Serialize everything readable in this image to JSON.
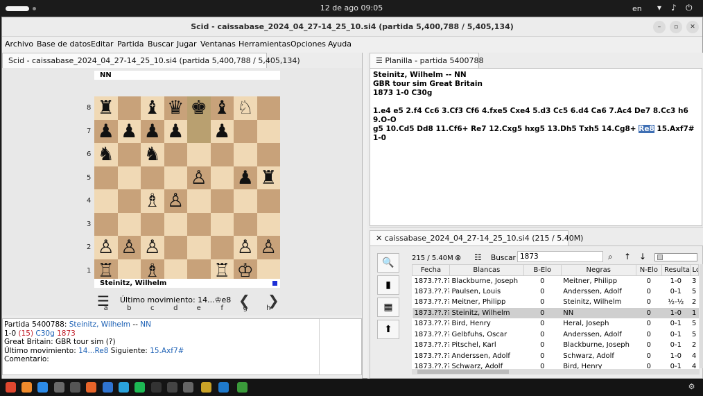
{
  "topbar": {
    "clock": "12 de ago  09:05",
    "lang": "en",
    "wifi_icon": "wifi-icon",
    "volume_icon": "volume-icon",
    "power_icon": "power-icon"
  },
  "window": {
    "title": "Scid - caissabase_2024_04_27-14_25_10.si4 (partida 5,400,788 / 5,405,134)",
    "minimize": "–",
    "restore": "▫",
    "close": "✕"
  },
  "menu": [
    "Archivo",
    "Base de datos",
    "Editar",
    "Partida",
    "Buscar",
    "Jugar",
    "Ventanas",
    "Herramientas",
    "Opciones",
    "Ayuda"
  ],
  "left": {
    "tab": "Scid - caissabase_2024_04_27-14_25_10.si4 (partida 5,400,788 / 5,405,134)",
    "black_player": "NN",
    "white_player": "Steinitz, Wilhelm",
    "ranks": [
      "8",
      "7",
      "6",
      "5",
      "4",
      "3",
      "2",
      "1"
    ],
    "files": [
      "a",
      "b",
      "c",
      "d",
      "e",
      "f",
      "g",
      "h"
    ],
    "board": [
      [
        "♜",
        "",
        "♝",
        "♛",
        "♚",
        "♝",
        "♘",
        ""
      ],
      [
        "♟",
        "♟",
        "♟",
        "♟",
        "",
        "♟",
        "",
        ""
      ],
      [
        "♞",
        "",
        "♞",
        "",
        "",
        "",
        "",
        ""
      ],
      [
        "",
        "",
        "",
        "",
        "♙",
        "",
        "♟",
        "♜"
      ],
      [
        "",
        "",
        "♗",
        "♙",
        "",
        "",
        "",
        ""
      ],
      [
        "",
        "",
        "",
        "",
        "",
        "",
        "",
        ""
      ],
      [
        "♙",
        "♙",
        "♙",
        "",
        "",
        "",
        "♙",
        "♙"
      ],
      [
        "♖",
        "",
        "♗",
        "",
        "",
        "♖",
        "♔",
        ""
      ]
    ],
    "last_move_label": "Último movimiento: 14...♔e8",
    "prev": "❮",
    "next": "❯",
    "info": {
      "line1_prefix": "Partida 5400788:",
      "white": "Steinitz, Wilhelm",
      "sep": "--",
      "black": "NN",
      "result": "1-0",
      "moves": "(15)",
      "eco": "C30g",
      "year": "1873",
      "event_prefix": "Great Britain:",
      "event": "GBR tour sim (?)",
      "last_label": "Último movimiento:",
      "last_move": "14...Re8",
      "next_label": "Siguiente:",
      "next_move": "15.Axf7#",
      "comment_label": "Comentario:"
    }
  },
  "right": {
    "notation_tab": "Planilla - partida 5400788",
    "header1": "Steinitz, Wilhelm   --   NN",
    "header2": "GBR tour sim  Great Britain",
    "header3": "1873  1-0  C30g",
    "moves_a": "1.e4 e5 2.f4 Cc6 3.Cf3 Cf6 4.fxe5 Cxe4 5.d3 Cc5 6.d4 Ca6 7.Ac4 De7 8.Cc3 h6 9.O-O",
    "moves_b": "g5 10.Cd5 Dd8 11.Cf6+ Re7 12.Cxg5 hxg5 13.Dh5 Txh5 14.Cg8+",
    "moves_hl": "Re8",
    "moves_c": "15.Axf7# 1-0",
    "gl_tab": "caissabase_2024_04_27-14_25_10.si4 (215 / 5.40M)",
    "count": "215 / 5.40M",
    "search_label": "Buscar",
    "search_value": "1873",
    "columns": [
      "Fecha",
      "Blancas",
      "B-Elo",
      "Negras",
      "N-Elo",
      "Resulta",
      "Lo"
    ],
    "rows": [
      [
        "1873.??.??",
        "Blackburne, Joseph",
        "0",
        "Meitner, Philipp",
        "0",
        "1-0",
        "3"
      ],
      [
        "1873.??.??",
        "Paulsen, Louis",
        "0",
        "Anderssen, Adolf",
        "0",
        "0-1",
        "5"
      ],
      [
        "1873.??.??",
        "Meitner, Philipp",
        "0",
        "Steinitz, Wilhelm",
        "0",
        "½-½",
        "2"
      ],
      [
        "1873.??.??",
        "Steinitz, Wilhelm",
        "0",
        "NN",
        "0",
        "1-0",
        "1"
      ],
      [
        "1873.??.??",
        "Bird, Henry",
        "0",
        "Heral, Joseph",
        "0",
        "0-1",
        "5"
      ],
      [
        "1873.??.??",
        "Gelbfuhs, Oscar",
        "0",
        "Anderssen, Adolf",
        "0",
        "0-1",
        "5"
      ],
      [
        "1873.??.??",
        "Pitschel, Karl",
        "0",
        "Blackburne, Joseph",
        "0",
        "0-1",
        "2"
      ],
      [
        "1873.??.??",
        "Anderssen, Adolf",
        "0",
        "Schwarz, Adolf",
        "0",
        "1-0",
        "4"
      ],
      [
        "1873.??.??",
        "Schwarz, Adolf",
        "0",
        "Bird, Henry",
        "0",
        "0-1",
        "4"
      ]
    ]
  }
}
